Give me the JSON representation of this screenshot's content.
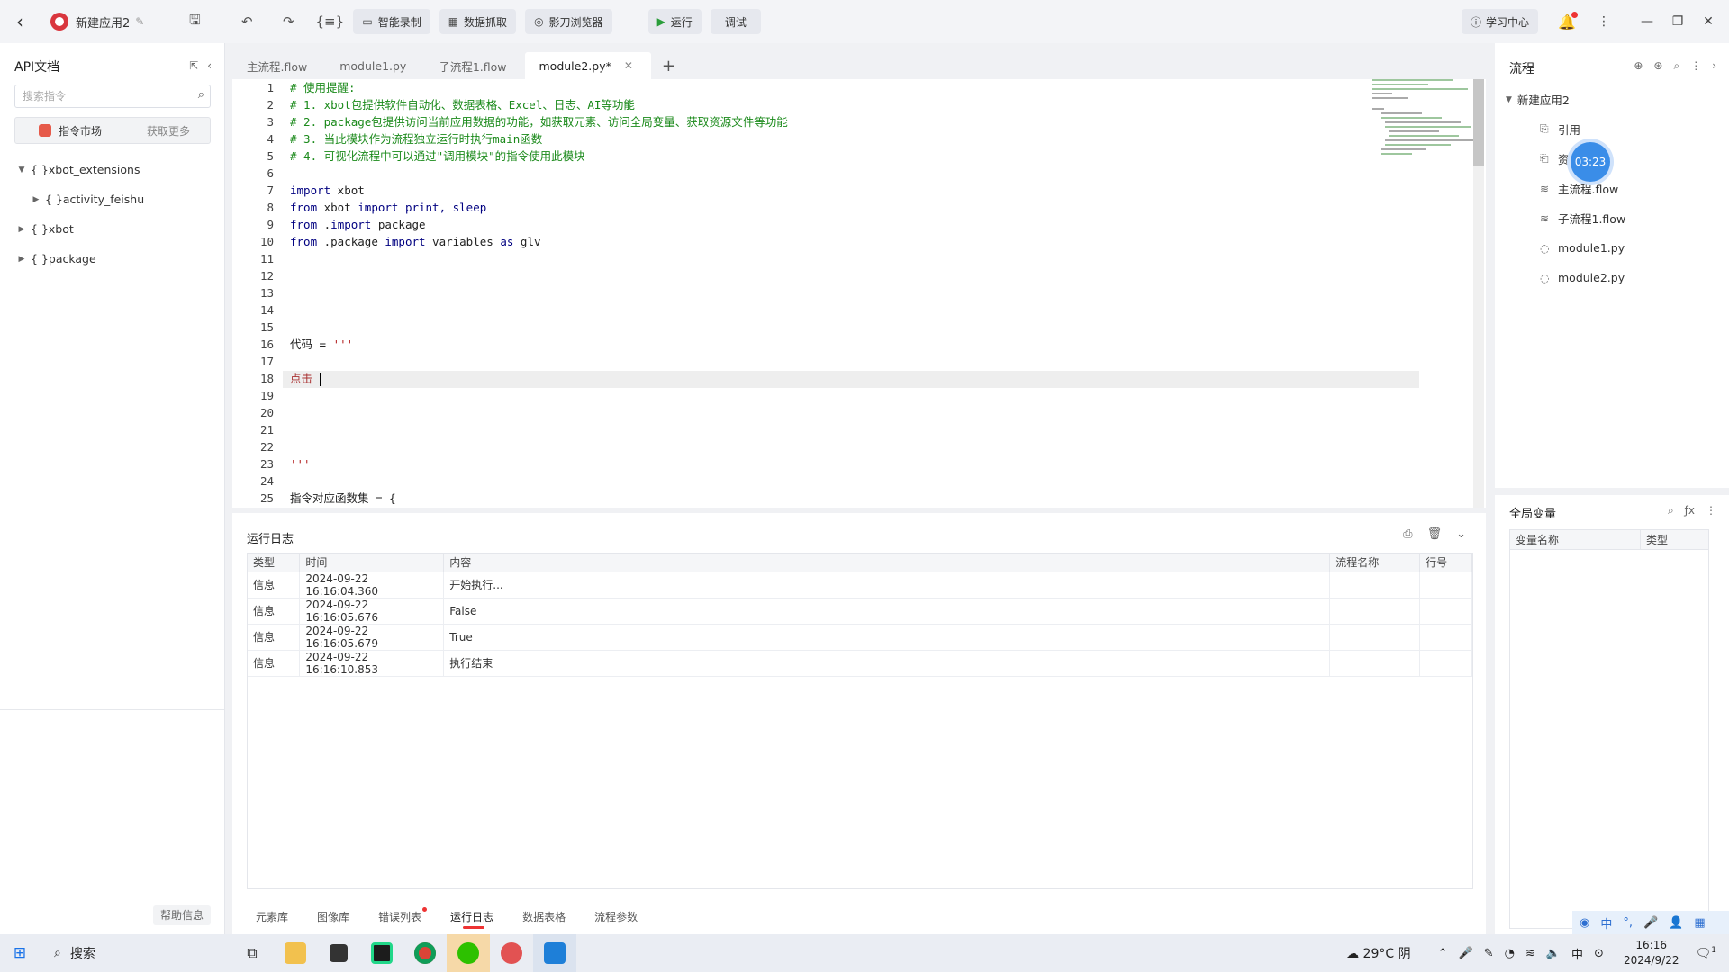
{
  "topbar": {
    "app_name": "新建应用2",
    "buttons": {
      "record": "智能录制",
      "grab": "数据抓取",
      "browser": "影刀浏览器",
      "run": "运行",
      "debug": "调试",
      "learn": "学习中心"
    }
  },
  "left_panel": {
    "title": "API文档",
    "search_placeholder": "搜索指令",
    "market_label": "指令市场",
    "market_more": "获取更多",
    "tree": [
      {
        "label": "xbot_extensions",
        "level": 0,
        "expanded": true
      },
      {
        "label": "activity_feishu",
        "level": 1,
        "expanded": false
      },
      {
        "label": "xbot",
        "level": 0,
        "expanded": false
      },
      {
        "label": "package",
        "level": 0,
        "expanded": false
      }
    ],
    "help": "帮助信息"
  },
  "editor": {
    "tabs": [
      {
        "label": "主流程.flow",
        "active": false
      },
      {
        "label": "module1.py",
        "active": false
      },
      {
        "label": "子流程1.flow",
        "active": false
      },
      {
        "label": "module2.py*",
        "active": true
      }
    ],
    "lines": [
      {
        "n": "1",
        "parts": [
          {
            "t": "# 使用提醒:",
            "c": "c-comment"
          }
        ]
      },
      {
        "n": "2",
        "parts": [
          {
            "t": "# 1. xbot包提供软件自动化、数据表格、Excel、日志、AI等功能",
            "c": "c-comment"
          }
        ]
      },
      {
        "n": "3",
        "parts": [
          {
            "t": "# 2. package包提供访问当前应用数据的功能，如获取元素、访问全局变量、获取资源文件等功能",
            "c": "c-comment"
          }
        ]
      },
      {
        "n": "4",
        "parts": [
          {
            "t": "# 3. 当此模块作为流程独立运行时执行main函数",
            "c": "c-comment"
          }
        ]
      },
      {
        "n": "5",
        "parts": [
          {
            "t": "# 4. 可视化流程中可以通过\"调用模块\"的指令使用此模块",
            "c": "c-comment"
          }
        ]
      },
      {
        "n": "6",
        "parts": []
      },
      {
        "n": "7",
        "parts": [
          {
            "t": "import",
            "c": "c-kw"
          },
          {
            "t": " xbot",
            "c": "c-text"
          }
        ]
      },
      {
        "n": "8",
        "parts": [
          {
            "t": "from",
            "c": "c-kw"
          },
          {
            "t": " xbot ",
            "c": "c-text"
          },
          {
            "t": "import",
            "c": "c-kw"
          },
          {
            "t": " print, sleep",
            "c": "c-kw"
          }
        ]
      },
      {
        "n": "9",
        "parts": [
          {
            "t": "from",
            "c": "c-kw"
          },
          {
            "t": " .",
            "c": "c-text"
          },
          {
            "t": "import",
            "c": "c-kw"
          },
          {
            "t": " package",
            "c": "c-text"
          }
        ]
      },
      {
        "n": "10",
        "parts": [
          {
            "t": "from",
            "c": "c-kw"
          },
          {
            "t": " .package ",
            "c": "c-text"
          },
          {
            "t": "import",
            "c": "c-kw"
          },
          {
            "t": " variables ",
            "c": "c-text"
          },
          {
            "t": "as",
            "c": "c-kw"
          },
          {
            "t": " glv",
            "c": "c-text"
          }
        ]
      },
      {
        "n": "11",
        "parts": []
      },
      {
        "n": "12",
        "parts": []
      },
      {
        "n": "13",
        "parts": []
      },
      {
        "n": "14",
        "parts": []
      },
      {
        "n": "15",
        "parts": []
      },
      {
        "n": "16",
        "parts": [
          {
            "t": "代码 = ",
            "c": "c-text"
          },
          {
            "t": "'''",
            "c": "c-str"
          }
        ]
      },
      {
        "n": "17",
        "parts": []
      },
      {
        "n": "18",
        "parts": [
          {
            "t": "点击 ",
            "c": "c-red"
          }
        ],
        "caret": true
      },
      {
        "n": "19",
        "parts": []
      },
      {
        "n": "20",
        "parts": []
      },
      {
        "n": "21",
        "parts": []
      },
      {
        "n": "22",
        "parts": []
      },
      {
        "n": "23",
        "parts": [
          {
            "t": "'''",
            "c": "c-str"
          }
        ]
      },
      {
        "n": "24",
        "parts": []
      },
      {
        "n": "25",
        "parts": [
          {
            "t": "指令对应函数集 = {",
            "c": "c-text"
          }
        ]
      }
    ]
  },
  "log": {
    "title": "运行日志",
    "headers": [
      "类型",
      "时间",
      "内容",
      "流程名称",
      "行号"
    ],
    "rows": [
      [
        "信息",
        "2024-09-22 16:16:04.360",
        "开始执行...",
        "",
        ""
      ],
      [
        "信息",
        "2024-09-22 16:16:05.676",
        "False",
        "",
        ""
      ],
      [
        "信息",
        "2024-09-22 16:16:05.679",
        "True",
        "",
        ""
      ],
      [
        "信息",
        "2024-09-22 16:16:10.853",
        "执行结束",
        "",
        ""
      ]
    ],
    "bottom_tabs": [
      "元素库",
      "图像库",
      "错误列表",
      "运行日志",
      "数据表格",
      "流程参数"
    ],
    "active_tab": "运行日志"
  },
  "right_panel": {
    "title": "流程",
    "root": "新建应用2",
    "items": [
      "引用",
      "资",
      "主流程.flow",
      "子流程1.flow",
      "module1.py",
      "module2.py"
    ],
    "timer": "03:23",
    "globals_title": "全局变量",
    "globals_headers": [
      "变量名称",
      "类型"
    ]
  },
  "taskbar": {
    "search": "搜索",
    "weather": "29°C 阴",
    "time": "16:16",
    "date": "2024/9/22",
    "notif_count": "1",
    "ime": "中"
  },
  "colors": {
    "accent_red": "#e33333",
    "comment_green": "#1b8a1b",
    "timer_blue": "#3a8de8"
  }
}
